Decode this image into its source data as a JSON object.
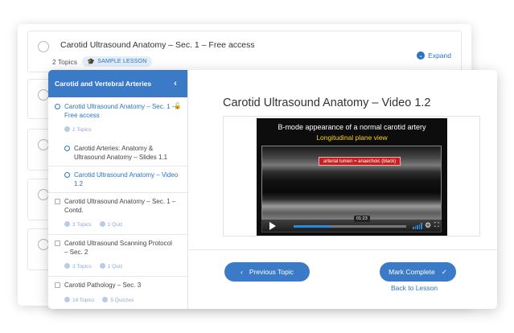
{
  "background_list": {
    "rows": [
      {
        "title": "Carotid Ultrasound Anatomy – Sec. 1 – Free access",
        "topics": "2 Topics",
        "badge": "SAMPLE LESSON",
        "expand": "Expand"
      }
    ]
  },
  "sidebar": {
    "header": "Carotid and Vertebral Arteries",
    "items": [
      {
        "label": "Carotid Ultrasound Anatomy – Sec. 1 – Free access",
        "meta_topics": "2 Topics"
      },
      {
        "label": "Carotid Arteries: Anatomy & Ultrasound Anatomy – Slides 1.1"
      },
      {
        "label": "Carotid Ultrasound Anatomy – Video 1.2"
      },
      {
        "label": "Carotid Ultrasound Anatomy – Sec. 1 – Contd.",
        "meta_topics": "3 Topics",
        "meta_quiz": "1 Quiz"
      },
      {
        "label": "Carotid Ultrasound Scanning Protocol – Sec. 2",
        "meta_topics": "3 Topics",
        "meta_quiz": "1 Quiz"
      },
      {
        "label": "Carotid Pathology – Sec. 3",
        "meta_topics": "14 Topics",
        "meta_quiz": "5 Quizzes"
      }
    ]
  },
  "main": {
    "title": "Carotid Ultrasound Anatomy – Video 1.2",
    "video": {
      "heading": "B-mode appearance of a normal carotid artery",
      "subheading": "Longitudinal plane view",
      "annotation": "arterial lumen = anaechoic (black)",
      "timestamp": "01:23",
      "progress": 0.33
    },
    "prev_button": "Previous Topic",
    "complete_button": "Mark Complete",
    "back_link": "Back to Lesson"
  },
  "colors": {
    "accent": "#3a7ac7",
    "link": "#2a74c5",
    "video_subtitle": "#ffd21a",
    "annotation": "#c62020"
  }
}
